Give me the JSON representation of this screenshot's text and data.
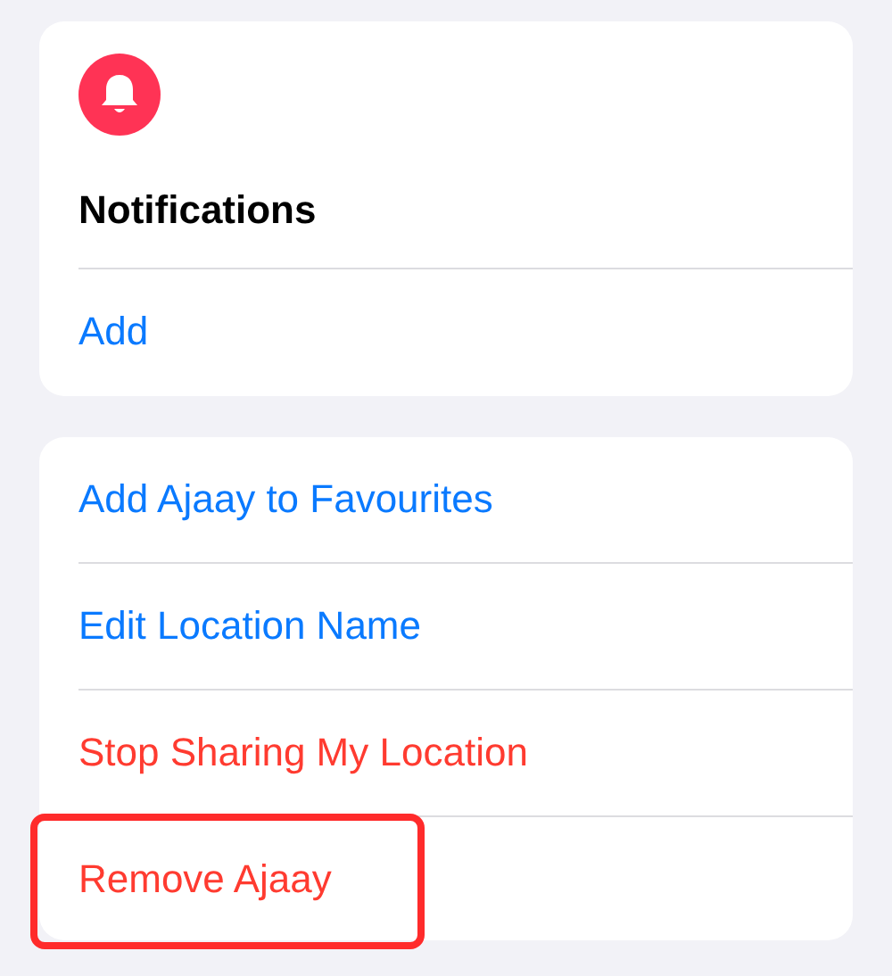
{
  "notifications": {
    "title": "Notifications",
    "action": "Add"
  },
  "actions": [
    {
      "label": "Add Ajaay to Favourites",
      "kind": "default",
      "highlighted": false
    },
    {
      "label": "Edit Location Name",
      "kind": "default",
      "highlighted": false
    },
    {
      "label": "Stop Sharing My Location",
      "kind": "destructive",
      "highlighted": false
    },
    {
      "label": "Remove Ajaay",
      "kind": "destructive",
      "highlighted": true
    }
  ]
}
